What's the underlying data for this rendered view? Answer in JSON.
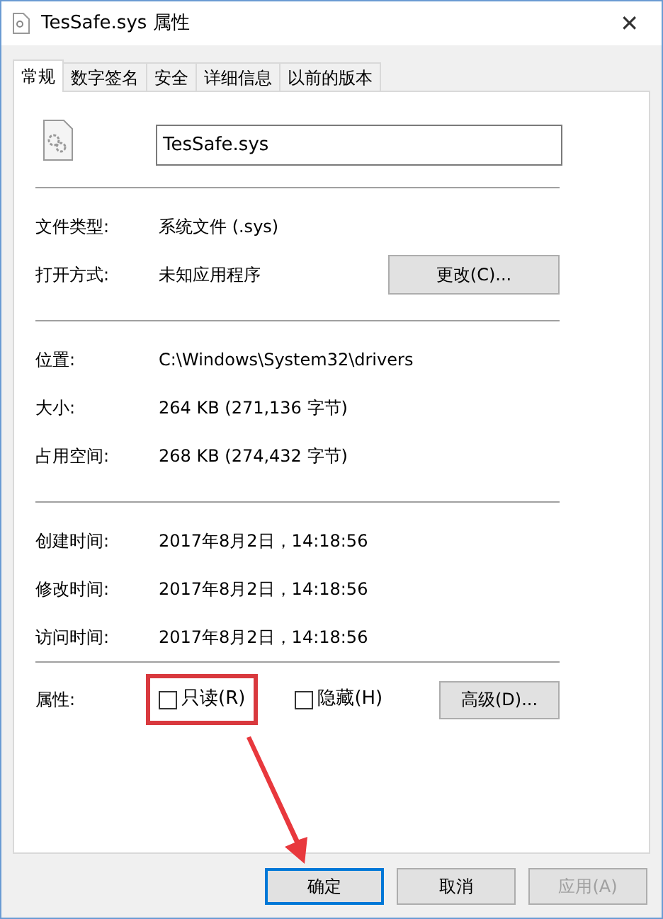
{
  "window": {
    "title": "TesSafe.sys 属性",
    "close": "✕"
  },
  "tabs": [
    {
      "label": "常规",
      "selected": true
    },
    {
      "label": "数字签名",
      "selected": false
    },
    {
      "label": "安全",
      "selected": false
    },
    {
      "label": "详细信息",
      "selected": false
    },
    {
      "label": "以前的版本",
      "selected": false
    }
  ],
  "file_name": "TesSafe.sys",
  "sections": [
    [
      {
        "label": "文件类型:",
        "value": "系统文件 (.sys)"
      },
      {
        "label": "打开方式:",
        "value": "未知应用程序",
        "button": "更改(C)..."
      }
    ],
    [
      {
        "label": "位置:",
        "value": "C:\\Windows\\System32\\drivers"
      },
      {
        "label": "大小:",
        "value": "264 KB (271,136 字节)"
      },
      {
        "label": "占用空间:",
        "value": "268 KB (274,432 字节)"
      }
    ],
    [
      {
        "label": "创建时间:",
        "value": "2017年8月2日，14:18:56"
      },
      {
        "label": "修改时间:",
        "value": "2017年8月2日，14:18:56"
      },
      {
        "label": "访问时间:",
        "value": "2017年8月2日，14:18:56"
      }
    ]
  ],
  "attributes": {
    "label": "属性:",
    "checkboxes": [
      {
        "label": "只读(R)",
        "checked": false,
        "highlighted": true
      },
      {
        "label": "隐藏(H)",
        "checked": false,
        "highlighted": false
      }
    ],
    "button": "高级(D)..."
  },
  "dialog_buttons": [
    {
      "label": "确定",
      "default": true,
      "disabled": false
    },
    {
      "label": "取消",
      "default": false,
      "disabled": false
    },
    {
      "label": "应用(A)",
      "default": false,
      "disabled": true
    }
  ]
}
